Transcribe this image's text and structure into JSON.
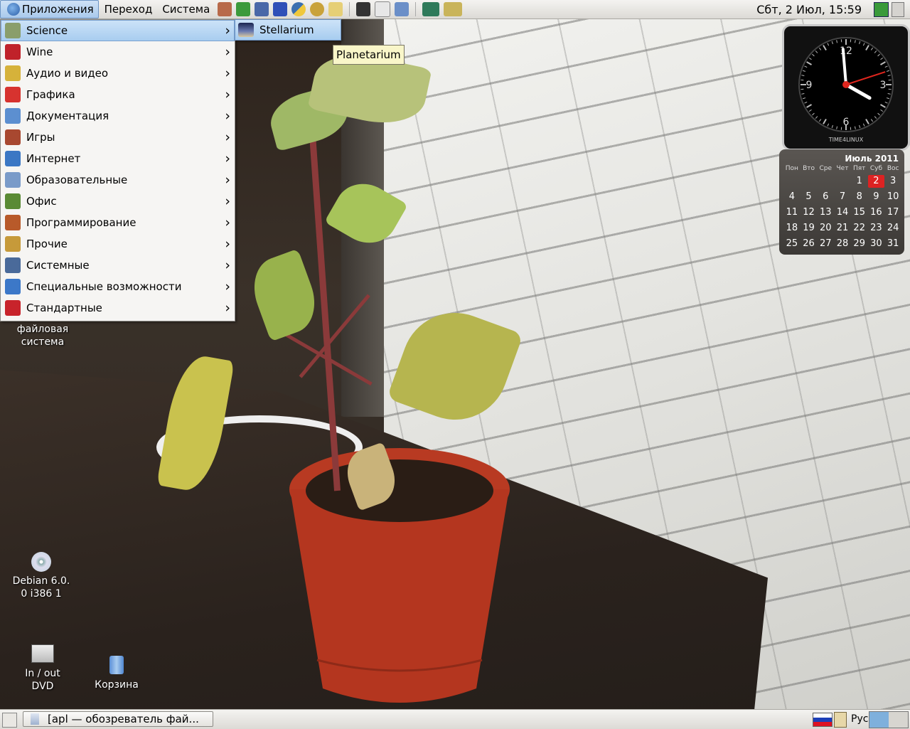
{
  "top_panel": {
    "menus": [
      "Приложения",
      "Переход",
      "Система"
    ],
    "clock": "Сбт,  2 Июл, 15:59"
  },
  "applications_menu": {
    "items": [
      {
        "label": "Science",
        "icon": "science-icon",
        "color": "#8a9e6b"
      },
      {
        "label": "Wine",
        "icon": "wine-icon",
        "color": "#c0222a"
      },
      {
        "label": "Аудио и видео",
        "icon": "multimedia-icon",
        "color": "#d6b23a"
      },
      {
        "label": "Графика",
        "icon": "graphics-icon",
        "color": "#d7332f"
      },
      {
        "label": "Документация",
        "icon": "documentation-icon",
        "color": "#5c8fd0"
      },
      {
        "label": "Игры",
        "icon": "games-icon",
        "color": "#a84830"
      },
      {
        "label": "Интернет",
        "icon": "internet-icon",
        "color": "#3b77c4"
      },
      {
        "label": "Образовательные",
        "icon": "education-icon",
        "color": "#7a9bc9"
      },
      {
        "label": "Офис",
        "icon": "office-icon",
        "color": "#5a8a34"
      },
      {
        "label": "Программирование",
        "icon": "programming-icon",
        "color": "#b85a2a"
      },
      {
        "label": "Прочие",
        "icon": "other-icon",
        "color": "#c69a3a"
      },
      {
        "label": "Системные",
        "icon": "system-icon",
        "color": "#4a6a9a"
      },
      {
        "label": "Специальные возможности",
        "icon": "accessibility-icon",
        "color": "#3c78c8"
      },
      {
        "label": "Стандартные",
        "icon": "accessories-icon",
        "color": "#c8232b"
      }
    ]
  },
  "science_submenu": {
    "items": [
      {
        "label": "Stellarium",
        "icon": "stellarium-icon"
      }
    ]
  },
  "tooltip": "Planetarium",
  "desktop_icons": {
    "filesystem": [
      "файловая",
      "система"
    ],
    "debian": [
      "Debian 6.0.",
      "0 i386 1"
    ],
    "dvd": [
      "In / out",
      "DVD"
    ],
    "trash": "Корзина"
  },
  "clock_widget": {
    "brand": "TIME4LINUX",
    "numerals": [
      "12",
      "3",
      "6",
      "9"
    ],
    "time": {
      "hour": 15,
      "minute": 59,
      "second": 12
    }
  },
  "calendar": {
    "title": "Июль 2011",
    "weekdays": [
      "Пон",
      "Вто",
      "Сре",
      "Чет",
      "Пят",
      "Суб",
      "Вос"
    ],
    "weeks": [
      [
        "",
        "",
        "",
        "",
        "1",
        "2",
        "3"
      ],
      [
        "4",
        "5",
        "6",
        "7",
        "8",
        "9",
        "10"
      ],
      [
        "11",
        "12",
        "13",
        "14",
        "15",
        "16",
        "17"
      ],
      [
        "18",
        "19",
        "20",
        "21",
        "22",
        "23",
        "24"
      ],
      [
        "25",
        "26",
        "27",
        "28",
        "29",
        "30",
        "31"
      ]
    ],
    "today": "2"
  },
  "bottom_panel": {
    "task": "[apl — обозреватель фай...",
    "layout": "Рус"
  },
  "colors": {
    "selection": "#a7ccef",
    "tooltip_bg": "#f9f6c9",
    "panel": "#dcdad5"
  }
}
